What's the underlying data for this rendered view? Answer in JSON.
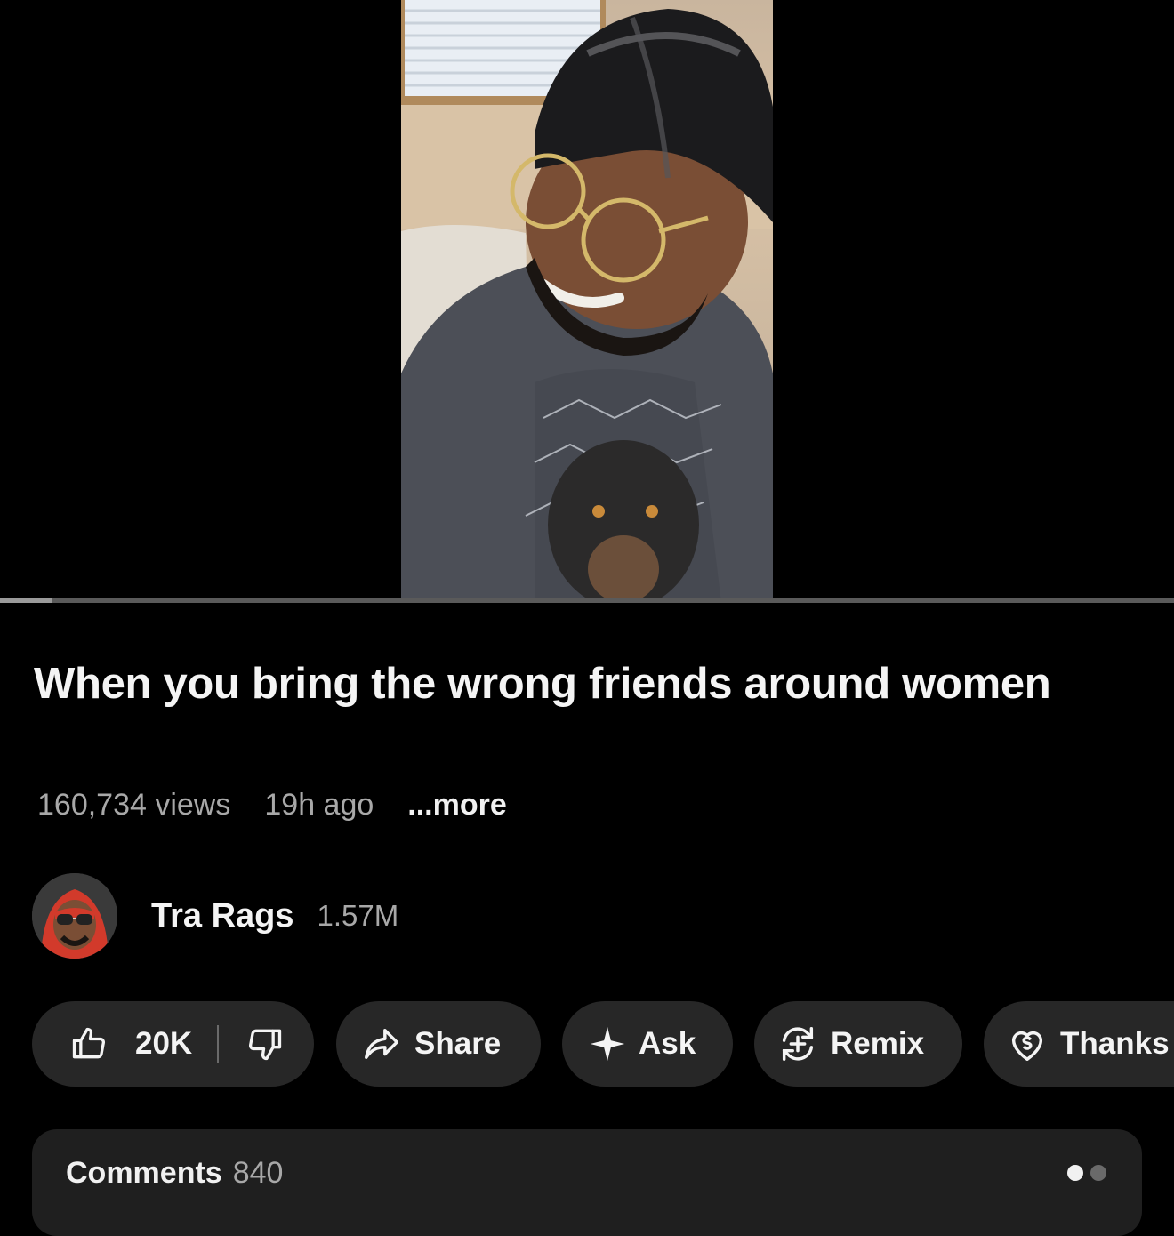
{
  "video": {
    "title": "When you bring the wrong friends around women",
    "views": "160,734 views",
    "age": "19h ago",
    "more_label": "...more",
    "progress": 0.045
  },
  "channel": {
    "name": "Tra Rags",
    "subscribers": "1.57M"
  },
  "actions": {
    "like_count": "20K",
    "share_label": "Share",
    "ask_label": "Ask",
    "remix_label": "Remix",
    "thanks_label": "Thanks"
  },
  "comments": {
    "label": "Comments",
    "count": "840"
  },
  "colors": {
    "background": "#000000",
    "pill": "#272727",
    "secondary_text": "#a8a8a8",
    "primary_text": "#f4f4f4"
  }
}
